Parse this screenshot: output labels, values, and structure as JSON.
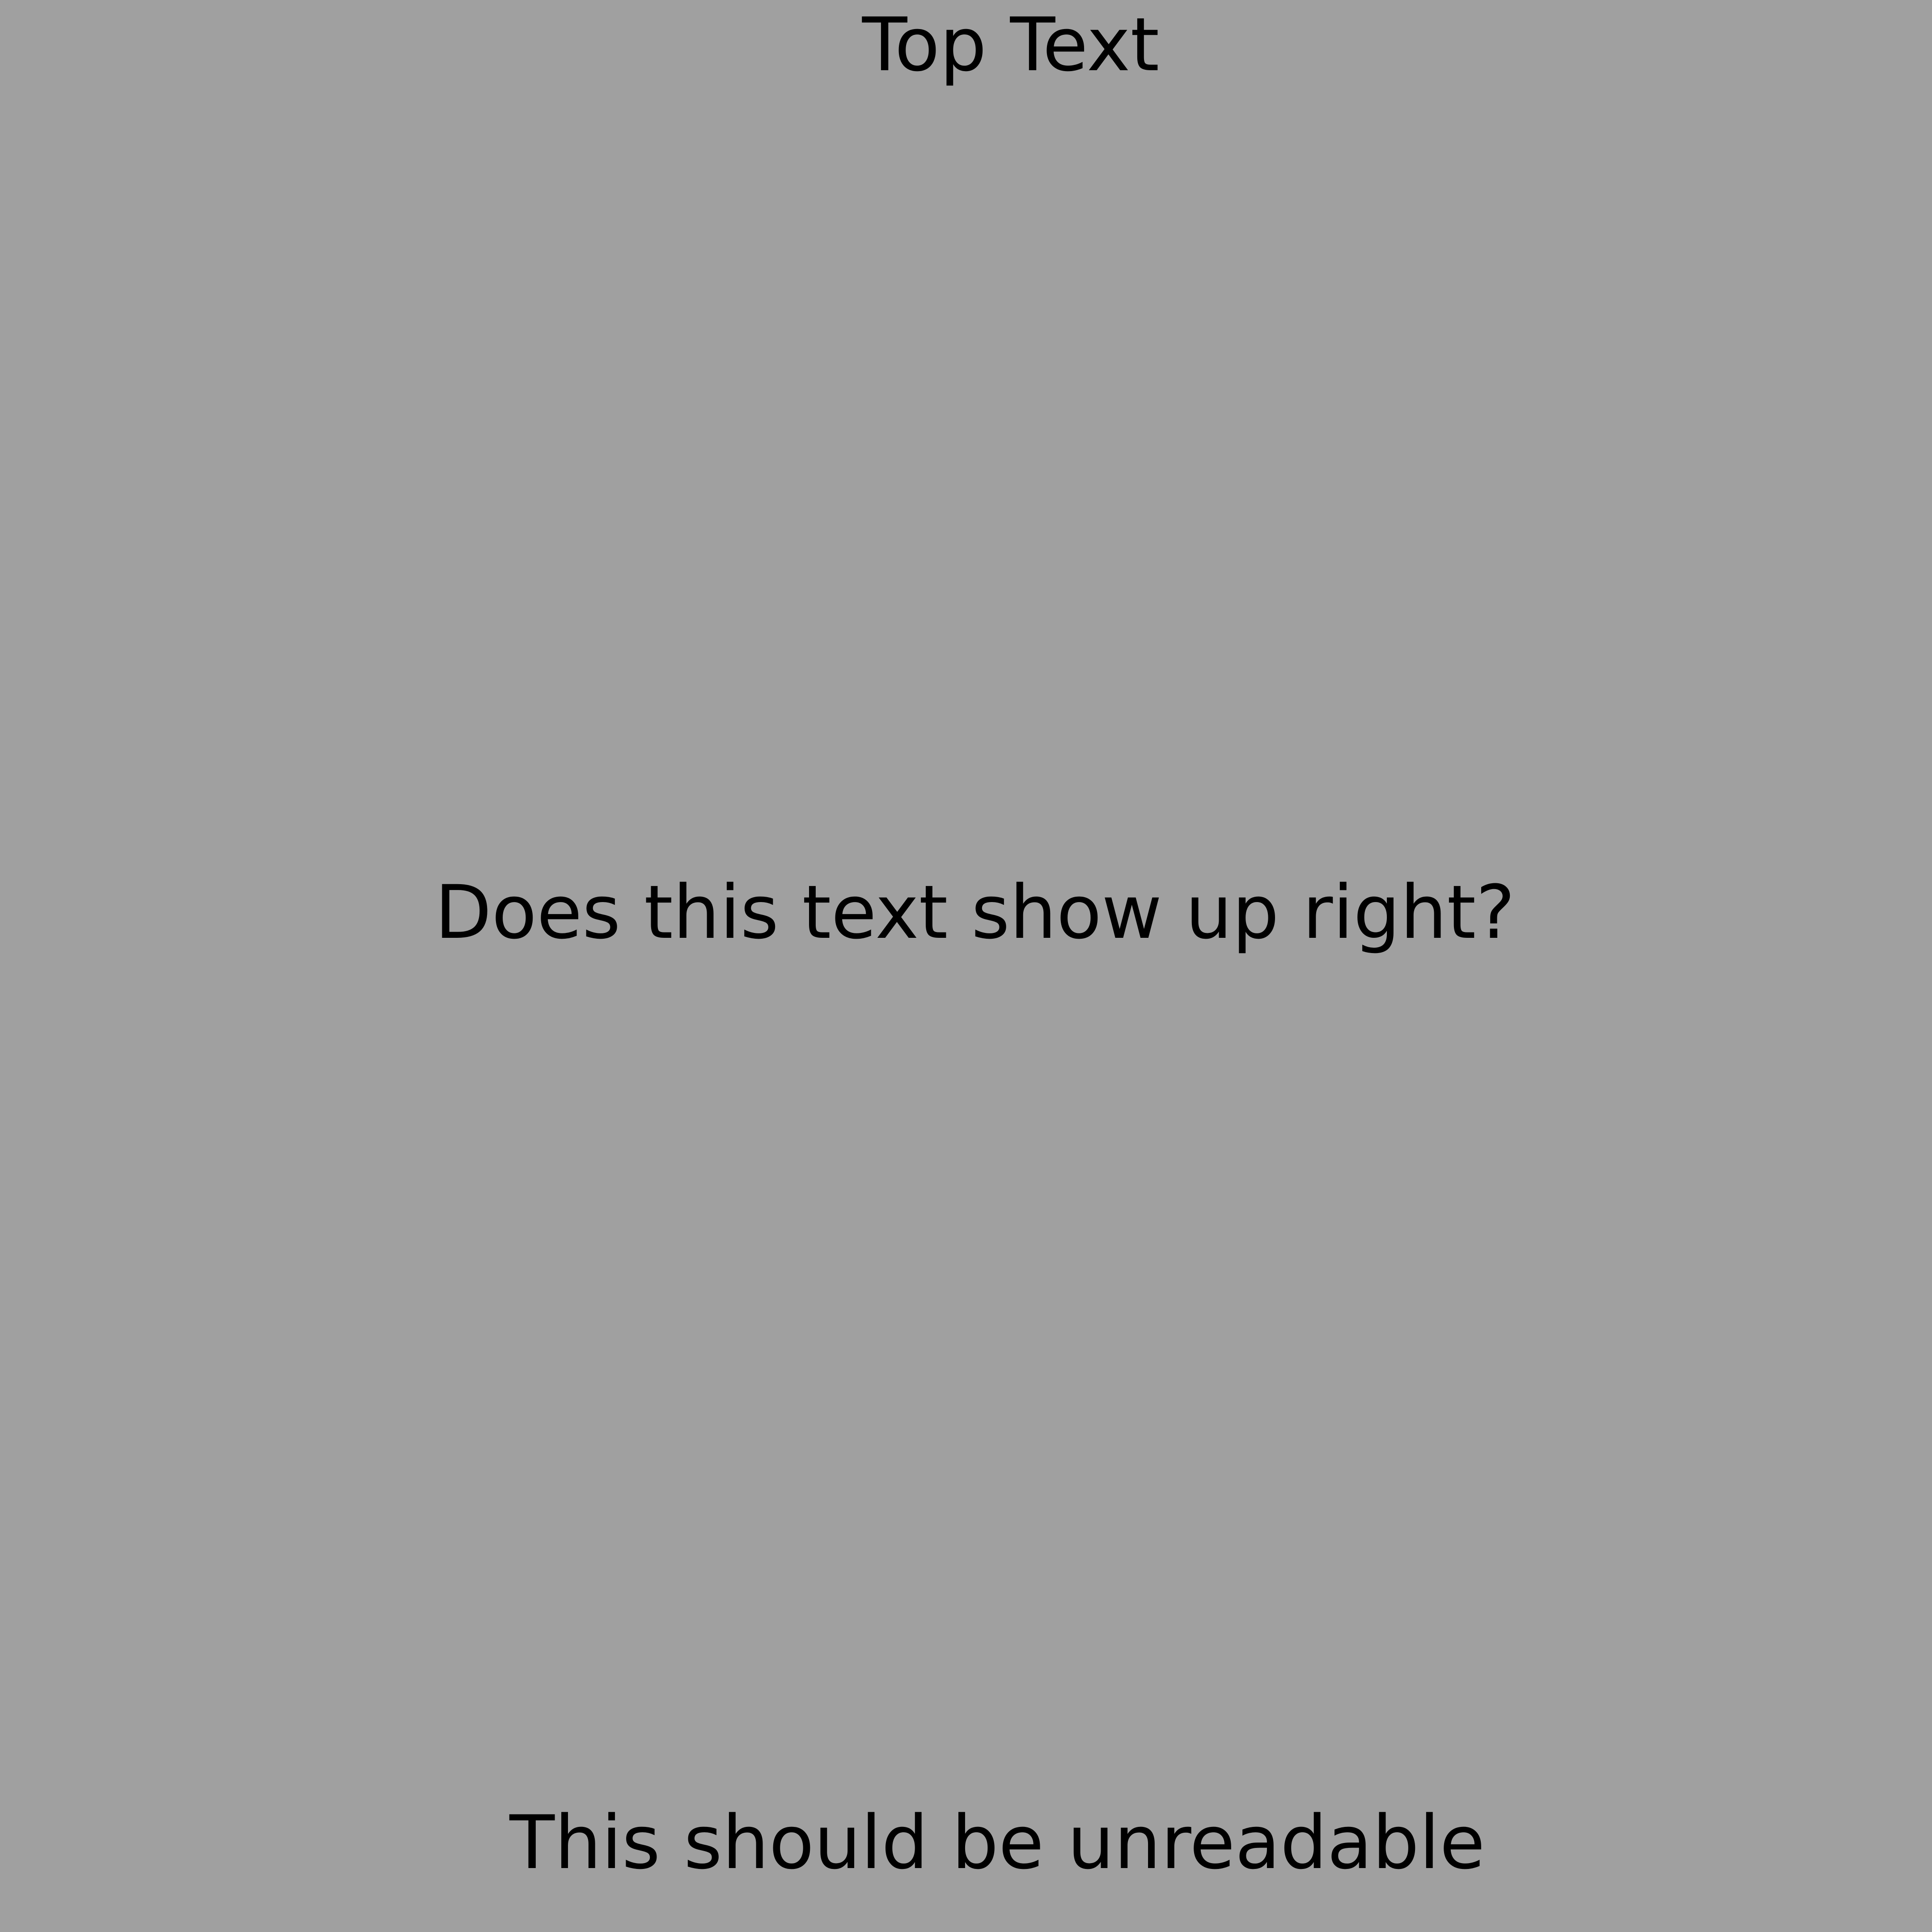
{
  "background_color": "#a0a0a0",
  "text_color": "#000000",
  "texts": {
    "top": "Top Text",
    "middle": "Does this text show up right?",
    "bottom": "This should be unreadable"
  }
}
